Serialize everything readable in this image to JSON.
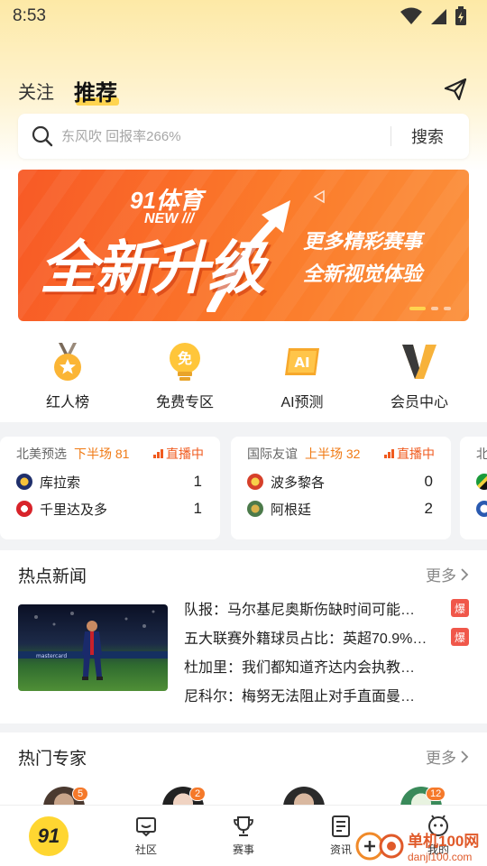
{
  "status_bar": {
    "time": "8:53"
  },
  "header": {
    "tabs": [
      {
        "label": "关注",
        "active": false
      },
      {
        "label": "推荐",
        "active": true
      }
    ]
  },
  "search": {
    "placeholder": "东风吹 回报率266%",
    "button_label": "搜索"
  },
  "banner": {
    "logo_text": "91体育",
    "new_text": "NEW ///",
    "title": "全新升级",
    "subtitle_1": "更多精彩赛事",
    "subtitle_2": "全新视觉体验"
  },
  "quick_links": [
    {
      "label": "红人榜",
      "icon": "medal-icon"
    },
    {
      "label": "免费专区",
      "icon": "free-bulb-icon"
    },
    {
      "label": "AI预测",
      "icon": "ai-icon"
    },
    {
      "label": "会员中心",
      "icon": "vip-icon"
    }
  ],
  "matches": [
    {
      "league": "北美预选",
      "status": "下半场 81",
      "live_label": "直播中",
      "home": {
        "name": "库拉索",
        "score": "1"
      },
      "away": {
        "name": "千里达及多",
        "score": "1"
      }
    },
    {
      "league": "国际友谊",
      "status": "上半场 32",
      "live_label": "直播中",
      "home": {
        "name": "波多黎各",
        "score": "0"
      },
      "away": {
        "name": "阿根廷",
        "score": "2"
      }
    },
    {
      "league": "北"
    }
  ],
  "hot_news": {
    "title": "热点新闻",
    "more_label": "更多",
    "items": [
      {
        "text": "队报：马尔基尼奥斯伤缺时间可能…",
        "tag": "爆"
      },
      {
        "text": "五大联赛外籍球员占比：英超70.9%…",
        "tag": "爆"
      },
      {
        "text": "杜加里：我们都知道齐达内会执教…",
        "tag": ""
      },
      {
        "text": "尼科尔：梅努无法阻止对手直面曼…",
        "tag": ""
      }
    ]
  },
  "experts": {
    "title": "热门专家",
    "more_label": "更多",
    "badges": [
      "5",
      "2",
      "",
      "12"
    ]
  },
  "bottom_nav": {
    "home_logo": "91",
    "items": [
      {
        "label": "社区",
        "icon": "community-icon"
      },
      {
        "label": "赛事",
        "icon": "trophy-icon"
      },
      {
        "label": "资讯",
        "icon": "news-icon"
      },
      {
        "label": "我的",
        "icon": "profile-icon"
      }
    ]
  },
  "watermark": {
    "name": "单机100网",
    "url": "danji100.com"
  },
  "colors": {
    "accent": "#ffd44f",
    "live": "#f05a1e",
    "hot_tag": "#f0574a",
    "banner": "#f96a28"
  }
}
